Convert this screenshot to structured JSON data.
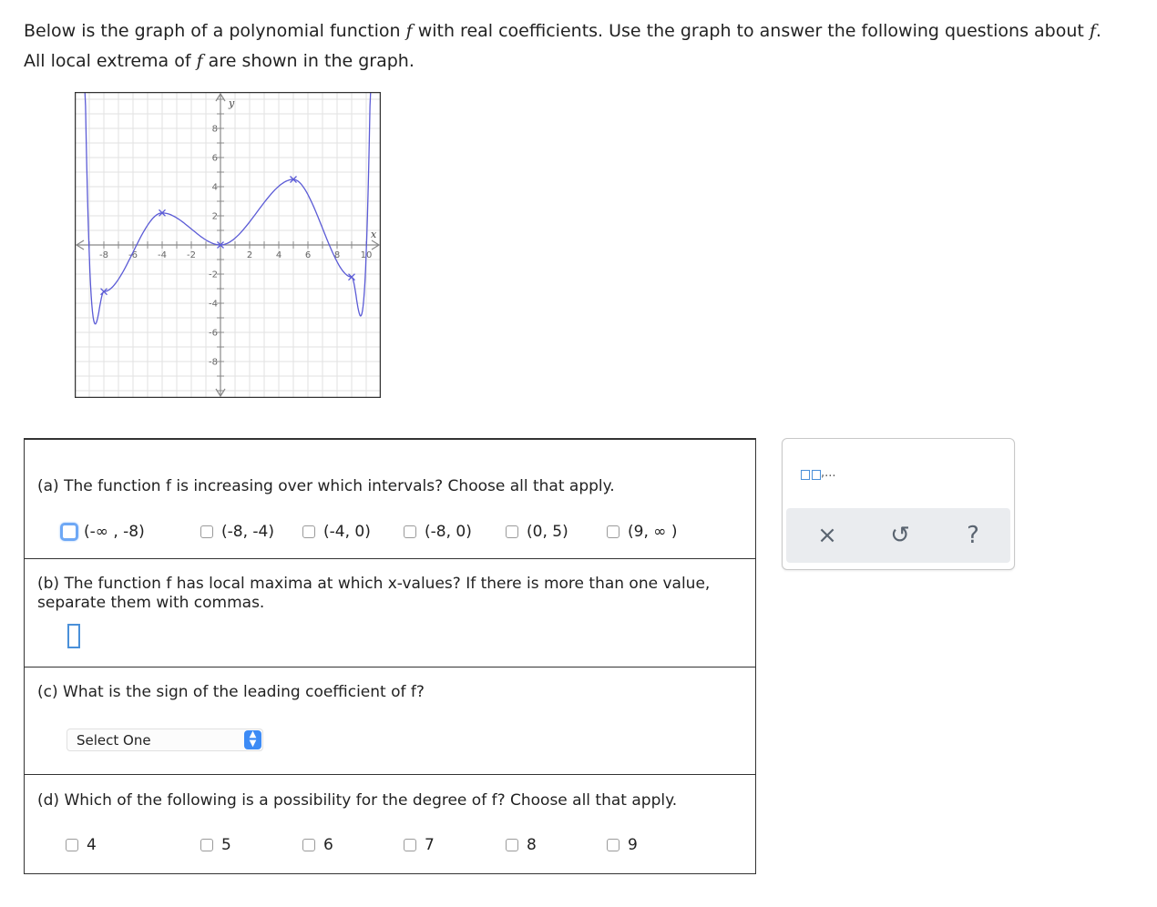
{
  "intro": {
    "line1_a": "Below is the graph of a polynomial function ",
    "var_f": "f",
    "line1_b": " with real coefficients. Use the graph to answer the following questions about ",
    "line1_c": ".",
    "line2_a": "All local extrema of ",
    "line2_b": " are shown in the graph."
  },
  "graph": {
    "x_axis_label": "x",
    "y_axis_label": "y",
    "x_ticks": [
      "-8",
      "-6",
      "-4",
      "-2",
      "2",
      "4",
      "6",
      "8",
      "10"
    ],
    "y_ticks": [
      "8",
      "6",
      "4",
      "2",
      "-2",
      "-4",
      "-6",
      "-8"
    ],
    "curve_color": "#5b5bd6",
    "local_extrema": [
      {
        "x": -8,
        "y": -3.2
      },
      {
        "x": -4,
        "y": 2.2
      },
      {
        "x": 0,
        "y": 0
      },
      {
        "x": 5,
        "y": 4.5
      },
      {
        "x": 9,
        "y": -2.2
      }
    ]
  },
  "qa": {
    "text": "(a) The function f is increasing over which intervals? Choose all that apply.",
    "options": [
      "(-∞ , -8)",
      "(-8, -4)",
      "(-4, 0)",
      "(-8, 0)",
      "(0, 5)",
      "(9, ∞ )"
    ]
  },
  "qb": {
    "text": "(b) The function f has local maxima at which x-values? If there is more than one value, separate them with commas."
  },
  "qc": {
    "text": "(c) What is the sign of the leading coefficient of f?",
    "select_value": "Select One"
  },
  "qd": {
    "text": "(d) Which of the following is a possibility for the degree of f? Choose all that apply.",
    "options": [
      "4",
      "5",
      "6",
      "7",
      "8",
      "9"
    ]
  },
  "panel": {
    "template_text": ",...",
    "clear_icon": "×",
    "undo_icon": "↺",
    "help_icon": "?"
  },
  "colors": {
    "accent_blue": "#3d8bf5",
    "curve": "#5b5bd6"
  }
}
